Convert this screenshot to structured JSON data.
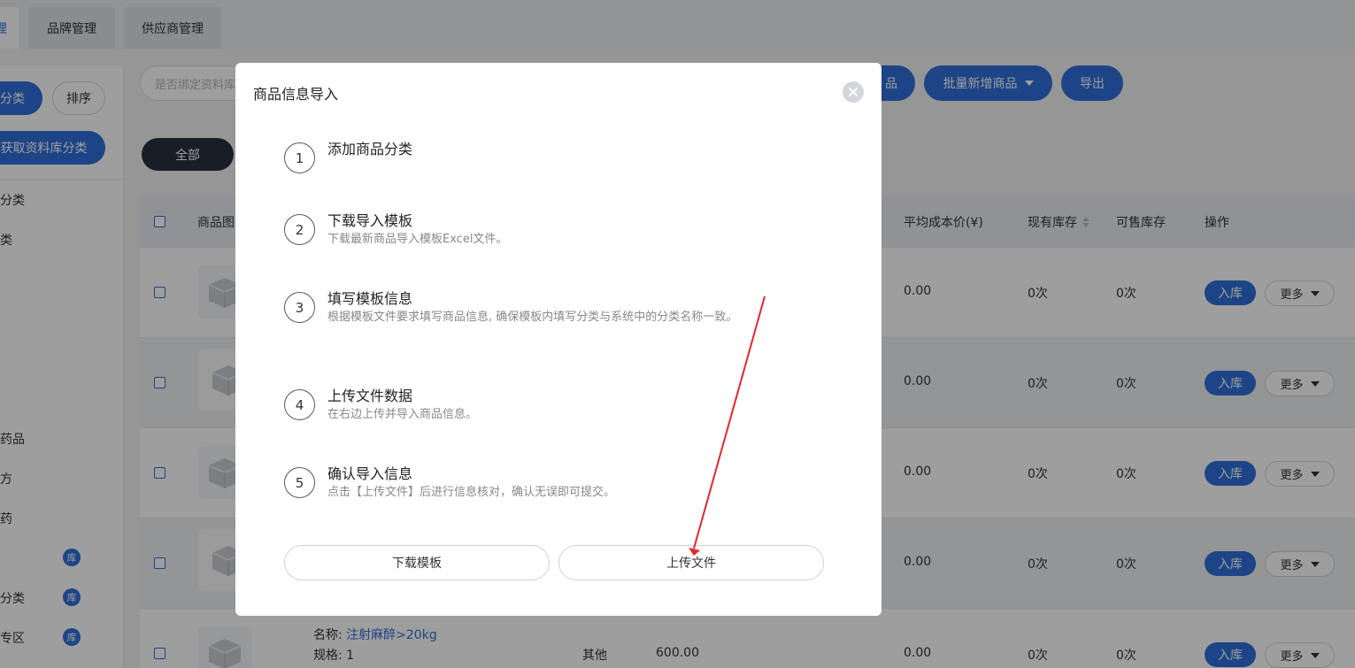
{
  "top_tabs": [
    {
      "label": "理"
    },
    {
      "label": "品牌管理"
    },
    {
      "label": "供应商管理"
    }
  ],
  "sidebar": {
    "category_button": "分类",
    "sort_button": "排序",
    "fetch_button": "获取资料库分类",
    "items": [
      {
        "label": "分类"
      },
      {
        "label": "类"
      },
      {
        "label": "药品"
      },
      {
        "label": "方"
      },
      {
        "label": "药"
      },
      {
        "label": "",
        "badge": "库"
      },
      {
        "label": "分类",
        "badge": "库"
      },
      {
        "label": "专区",
        "badge": "库"
      }
    ]
  },
  "toolbar": {
    "filter_placeholder": "是否绑定资料库",
    "add_product_partial": "品",
    "batch_add": "批量新增商品",
    "export": "导出"
  },
  "filter_tabs": {
    "all": "全部"
  },
  "table": {
    "headers": {
      "image": "商品图",
      "avg_cost": "平均成本价(¥)",
      "stock": "现有库存",
      "sellable": "可售库存",
      "actions": "操作"
    },
    "rows": [
      {
        "avg_cost": "0.00",
        "stock": "0次",
        "sellable": "0次"
      },
      {
        "avg_cost": "0.00",
        "stock": "0次",
        "sellable": "0次"
      },
      {
        "avg_cost": "0.00",
        "stock": "0次",
        "sellable": "0次"
      },
      {
        "avg_cost": "0.00",
        "stock": "0次",
        "sellable": "0次"
      },
      {
        "name_label": "名称:",
        "name_value": "注射麻醉>20kg",
        "spec_label": "规格:",
        "spec_value": "1",
        "category": "其他",
        "price": "600.00",
        "avg_cost": "0.00",
        "stock": "0次",
        "sellable": "0次"
      }
    ],
    "in_stock_label": "入库",
    "more_label": "更多"
  },
  "modal": {
    "title": "商品信息导入",
    "steps": [
      {
        "num": "1",
        "title": "添加商品分类",
        "desc": ""
      },
      {
        "num": "2",
        "title": "下载导入模板",
        "desc": "下载最新商品导入模板Excel文件。"
      },
      {
        "num": "3",
        "title": "填写模板信息",
        "desc": "根据模板文件要求填写商品信息, 确保模板内填写分类与系统中的分类名称一致。"
      },
      {
        "num": "4",
        "title": "上传文件数据",
        "desc": "在右边上传并导入商品信息。"
      },
      {
        "num": "5",
        "title": "确认导入信息",
        "desc": "点击【上传文件】后进行信息核对，确认无误即可提交。"
      }
    ],
    "download_button": "下载模板",
    "upload_button": "上传文件"
  },
  "colors": {
    "primary": "#2f6fd8",
    "dark_pill": "#273142",
    "annotation_arrow": "#e8252b"
  }
}
